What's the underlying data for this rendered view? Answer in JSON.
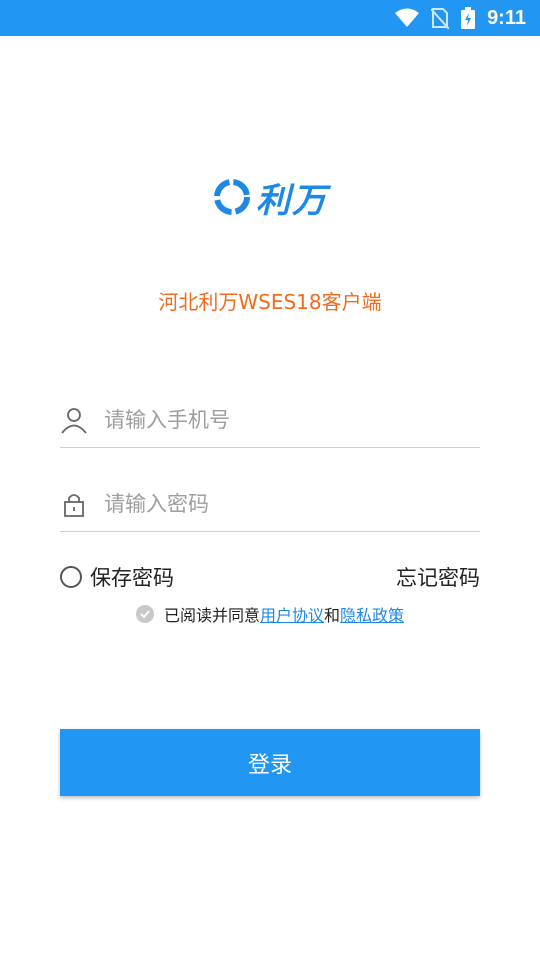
{
  "status_bar": {
    "time": "9:11"
  },
  "logo": {
    "text": "利万"
  },
  "subtitle": "河北利万WSES18客户端",
  "form": {
    "phone_placeholder": "请输入手机号",
    "password_placeholder": "请输入密码"
  },
  "options": {
    "save_password": "保存密码",
    "forgot_password": "忘记密码"
  },
  "agreement": {
    "prefix": "已阅读并同意",
    "user_agreement": "用户协议",
    "and": "和",
    "privacy_policy": "隐私政策"
  },
  "login_button": "登录",
  "colors": {
    "primary": "#2196f3",
    "accent_orange": "#f26b1d"
  }
}
